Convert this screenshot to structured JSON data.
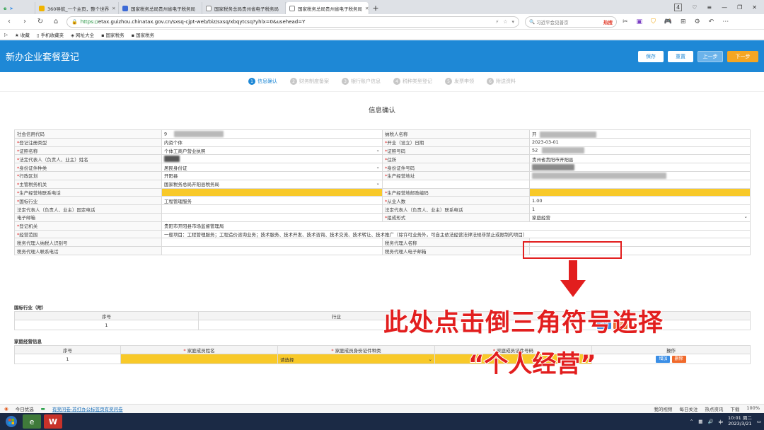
{
  "browser": {
    "tabs": [
      {
        "label": "360导航_一个主页，整个世界",
        "active": false
      },
      {
        "label": "国家税务总局贵州省电子税务局",
        "active": false
      },
      {
        "label": "国家税务总局贵州省电子税务局",
        "active": false
      },
      {
        "label": "国家税务总局贵州省电子税务局",
        "active": true
      }
    ],
    "address_proto": "https://",
    "address_rest": "etax.guizhou.chinatax.gov.cn/sxsq-cjpt-web/biz/sxsq/xbqytcsq?yhlx=0&usehead=Y",
    "search_placeholder": "习近平会见普京",
    "search_hot": "热搜",
    "bookmarks": [
      "收藏",
      "手机收藏夹",
      "网址大全",
      "国家税务",
      "国家税务"
    ],
    "win_count": "4"
  },
  "header": {
    "title": "新办企业套餐登记",
    "buttons": {
      "save": "保存",
      "reset": "重置",
      "prev": "上一步",
      "next": "下一步"
    }
  },
  "steps": [
    {
      "num": "1",
      "label": "信息确认"
    },
    {
      "num": "2",
      "label": "财务制度备案"
    },
    {
      "num": "3",
      "label": "银行账户信息"
    },
    {
      "num": "4",
      "label": "税种类型登记"
    },
    {
      "num": "5",
      "label": "发票申领"
    },
    {
      "num": "6",
      "label": "附送资料"
    }
  ],
  "section_title": "信息确认",
  "form": {
    "credit_code_label": "社会信用代码",
    "credit_code_value": "9",
    "taxpayer_name_label": "纳税人名称",
    "taxpayer_name_value": "开",
    "reg_type_label": "登记注册类型",
    "reg_type_value": "内资个体",
    "open_date_label": "开业（设立）日期",
    "open_date_value": "2023-03-01",
    "cert_name_label": "证照名称",
    "cert_name_value": "个体工商户营业执照",
    "cert_no_label": "证照号码",
    "cert_no_value": "52",
    "legal_name_label": "法定代表人（负责人、业主）姓名",
    "address_label": "住所",
    "address_value": "贵州省贵阳市开阳县",
    "id_type_label": "身份证件种类",
    "id_type_value": "居民身份证",
    "id_no_label": "身份证件号码",
    "district_label": "行政区划",
    "district_value": "开阳县",
    "biz_address_label": "生产经营地址",
    "tax_authority_label": "主管税务机关",
    "tax_authority_value": "国家税务总局开阳县税务局",
    "biz_phone_label": "生产经营地联系电话",
    "biz_postcode_label": "生产经营地邮政编码",
    "industry_label": "国标行业",
    "industry_value": "工程管理服务",
    "employees_label": "从业人数",
    "employees_value": "1.00",
    "legal_landline_label": "法定代表人（负责人、业主）固定电话",
    "legal_mobile_label": "法定代表人（负责人、业主）联系电话",
    "legal_mobile_value": "1",
    "email_label": "电子邮箱",
    "composition_label": "组成形式",
    "composition_value": "家庭经营",
    "reg_authority_label": "登记机关",
    "reg_authority_value": "贵阳市开阳县市场监督管理局",
    "scope_label": "经营范围",
    "scope_value": "一般项目：工程管理服务；工程造价咨询业务；技术服务、技术开发、技术咨询、技术交流、技术转让、技术推广（除许可业务外，可自主依法经营法律法规非禁止或限制的项目）",
    "agent_id_label": "税务代理人纳税人识别号",
    "agent_name_label": "税务代理人名称",
    "agent_phone_label": "税务代理人联系电话",
    "agent_email_label": "税务代理人电子邮箱"
  },
  "industry_table": {
    "title": "国标行业（附）",
    "headers": [
      "序号",
      "行业"
    ],
    "rows": [
      [
        "1",
        ""
      ]
    ],
    "add_label": "增加",
    "del_label": "删除"
  },
  "family_table": {
    "title": "家庭经营信息",
    "headers": [
      "序号",
      "家庭成员姓名",
      "家庭成员身份证件种类",
      "家庭成员证件号码",
      "操作"
    ],
    "rows": [
      {
        "num": "1",
        "name": "",
        "id_type": "请选择",
        "id_no": ""
      }
    ],
    "add_label": "增加",
    "del_label": "删除"
  },
  "annotation": {
    "line1": "此处点击倒三角符号选择",
    "line2": "“个人经营”",
    "color": "#e21e1e"
  },
  "statusbar": {
    "left": "今日优选",
    "news": "有奖问卷-苏打办公标签页有奖问卷",
    "right": [
      "我的视频",
      "每日关注",
      "热点资讯",
      "下载",
      "100%"
    ]
  },
  "taskbar": {
    "time": "10:01 周二",
    "date": "2023/3/21"
  }
}
